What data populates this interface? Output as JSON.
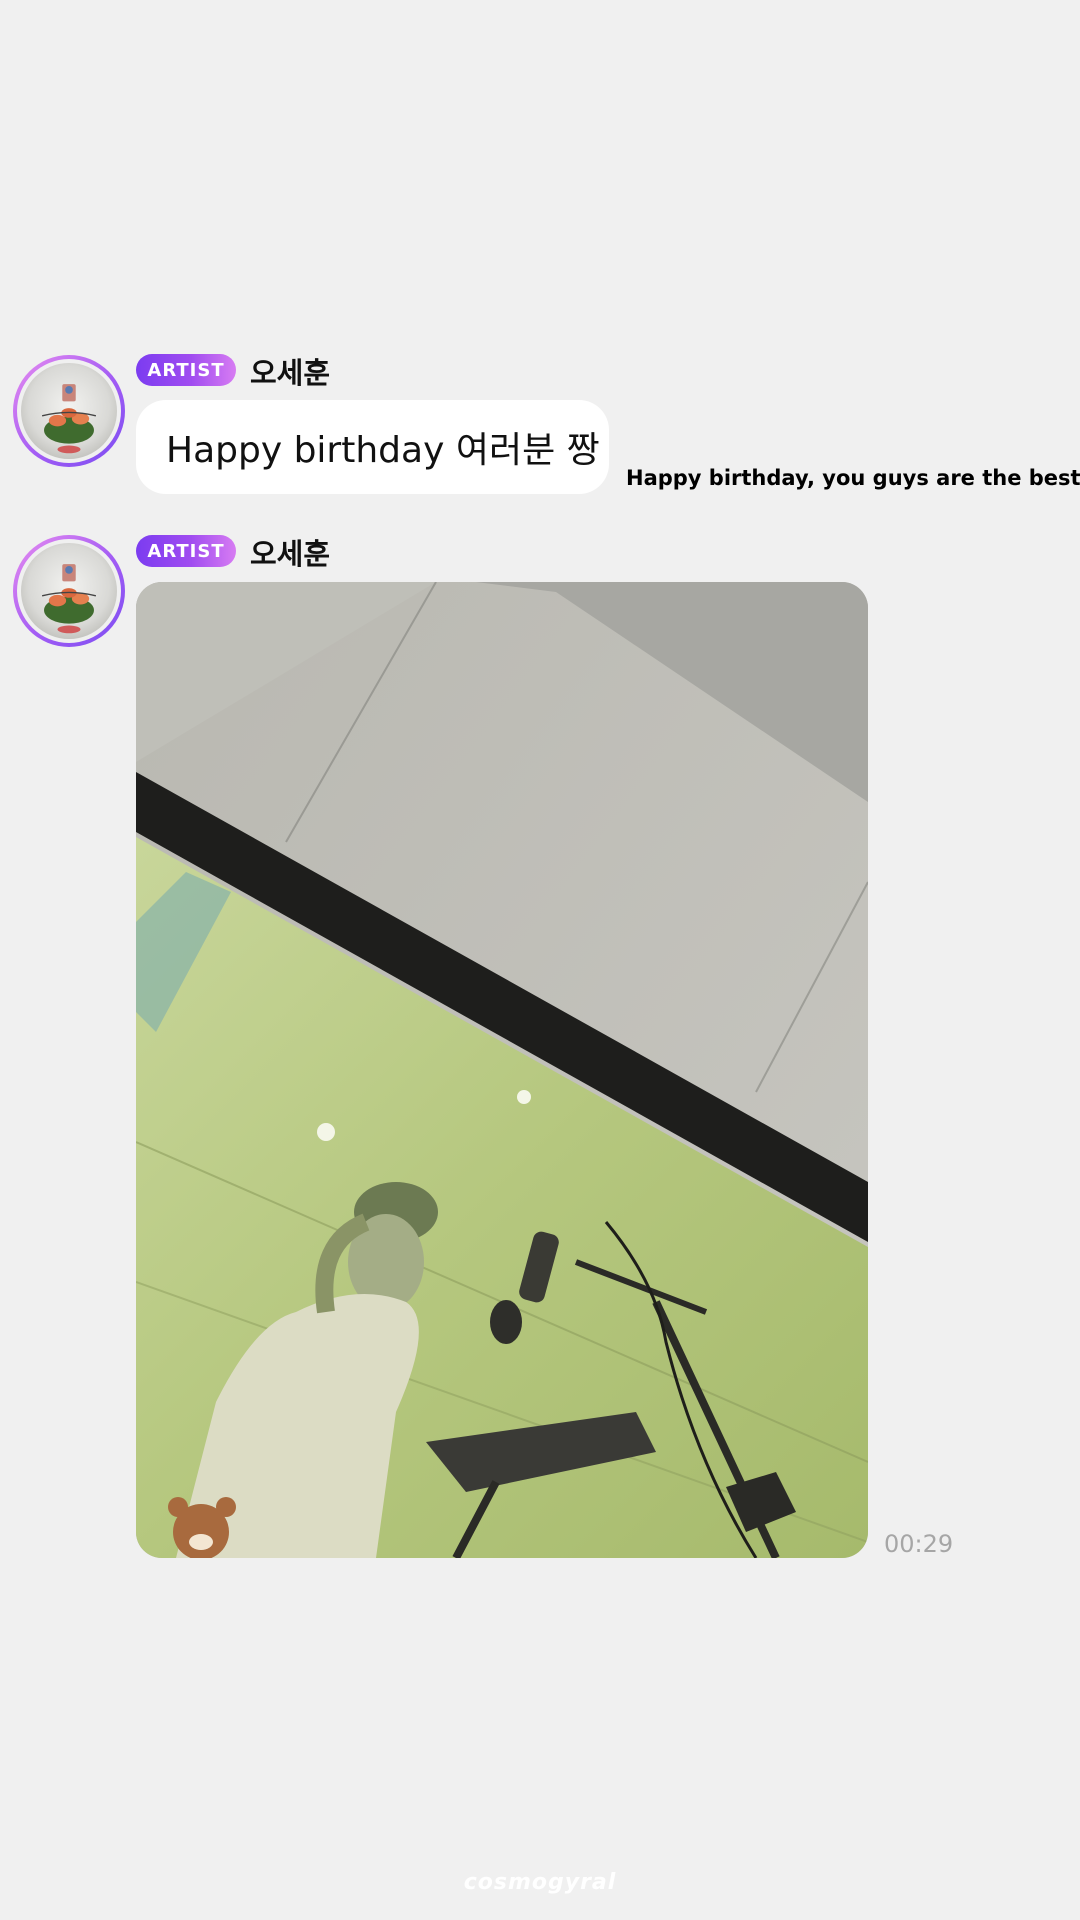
{
  "colors": {
    "background": "#f0f0f0",
    "badge_gradient_start": "#7b3cf0",
    "badge_gradient_end": "#d77cf2",
    "bubble": "#ffffff",
    "timestamp": "#a6a6a6"
  },
  "messages": [
    {
      "badge": "ARTIST",
      "sender": "오세훈",
      "text": "Happy birthday 여러분 짱",
      "translation": "Happy birthday, you guys are the best"
    },
    {
      "badge": "ARTIST",
      "sender": "오세훈",
      "media": "photo",
      "time": "00:29"
    }
  ],
  "watermark": "cosmogyral"
}
